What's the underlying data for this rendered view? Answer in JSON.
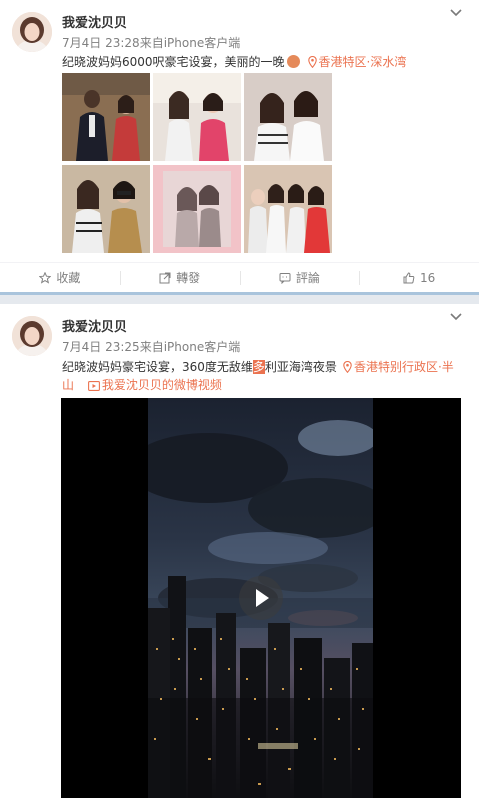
{
  "posts": [
    {
      "author": "我爱沈贝贝",
      "date": "7月4日",
      "time": "23:28",
      "source": "来自iPhone客户端",
      "text_prefix": "纪晓波妈妈6000呎豪宅设宴，美丽的一晚",
      "location": "香港特区·深水湾",
      "actions": {
        "favorite": "收藏",
        "repost": "轉發",
        "comment": "評論",
        "like_count": "16"
      }
    },
    {
      "author": "我爱沈贝贝",
      "date": "7月4日",
      "time": "23:25",
      "source": "来自iPhone客户端",
      "text_prefix": "纪晓波妈妈豪宅设宴，360度无敌维",
      "text_highlight": "多",
      "text_suffix": "利亚海湾夜景",
      "location_line1": "香港特别行政区·半",
      "location_line2": "山",
      "video_link": "我爱沈贝贝的微博视频"
    }
  ],
  "colors": {
    "accent": "#eb7350",
    "meta": "#808080",
    "divider": "#a9c4dc"
  },
  "icons": [
    "chevron-down-icon",
    "location-pin-icon",
    "star-icon",
    "repost-icon",
    "comment-icon",
    "thumbs-up-icon",
    "video-icon",
    "play-icon"
  ]
}
